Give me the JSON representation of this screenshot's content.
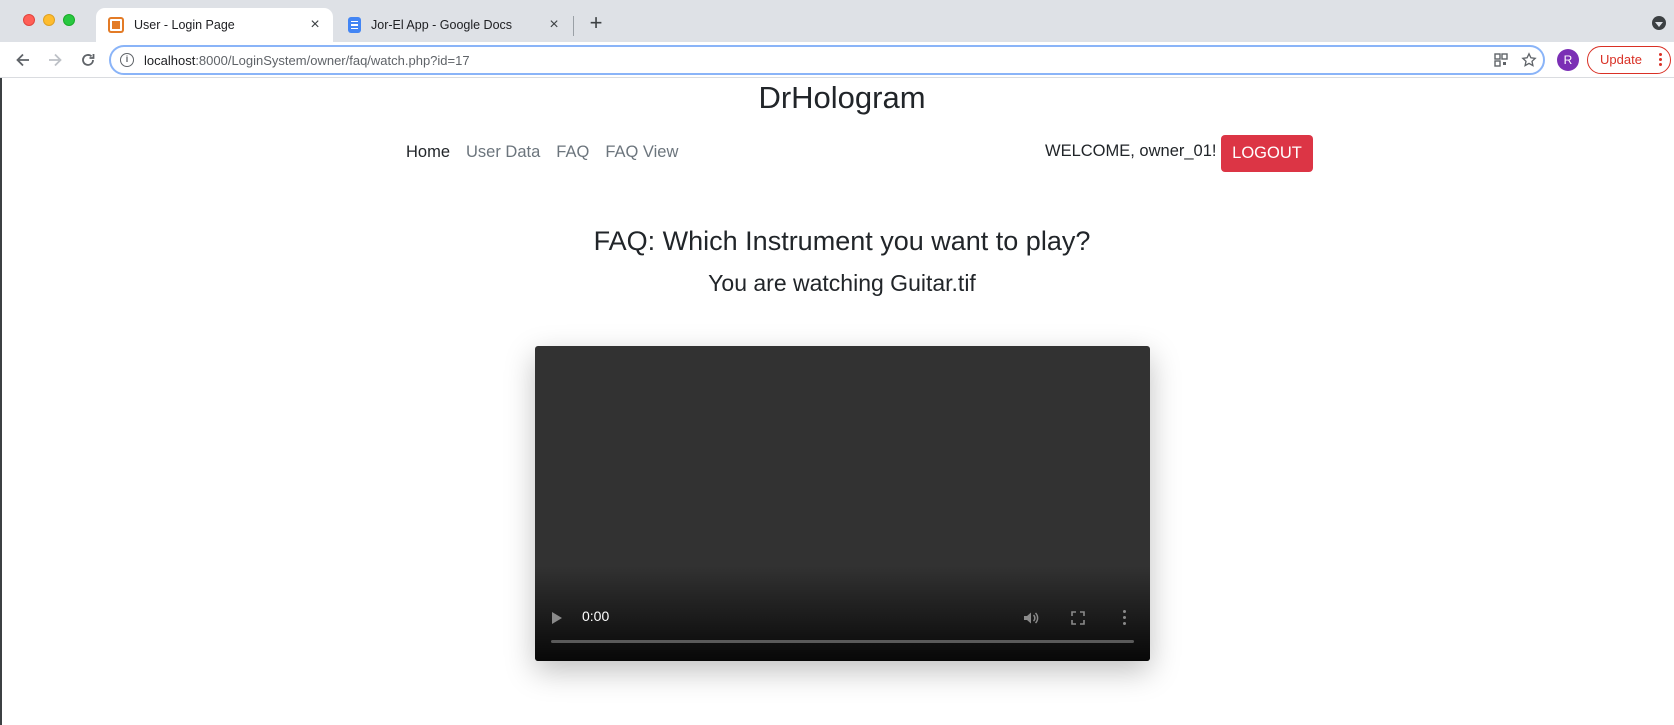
{
  "browser": {
    "tabs": [
      {
        "title": "User - Login Page",
        "favicon": "login-favicon",
        "active": true
      },
      {
        "title": "Jor-El App - Google Docs",
        "favicon": "google-docs-favicon",
        "active": false
      }
    ],
    "new_tab_label": "+",
    "url_host": "localhost",
    "url_rest": ":8000/LoginSystem/owner/faq/watch.php?id=17",
    "profile_initial": "R",
    "update_label": "Update",
    "colors": {
      "tabstrip": "#dee1e6",
      "update": "#d93025",
      "profile": "#7b2fb5"
    }
  },
  "site": {
    "brand": "DrHologram",
    "nav": [
      {
        "label": "Home",
        "active": true
      },
      {
        "label": "User Data",
        "active": false
      },
      {
        "label": "FAQ",
        "active": false
      },
      {
        "label": "FAQ View",
        "active": false
      }
    ],
    "welcome": "WELCOME, owner_01! -",
    "logout_label": "LOGOUT",
    "logout_color": "#dc3545"
  },
  "content": {
    "faq_title": "FAQ: Which Instrument you want to play?",
    "watching": "You are watching Guitar.tif"
  },
  "video": {
    "time": "0:00",
    "progress_fraction": 0,
    "controls": [
      "play-icon",
      "volume-icon",
      "fullscreen-icon",
      "more-options-icon"
    ]
  }
}
